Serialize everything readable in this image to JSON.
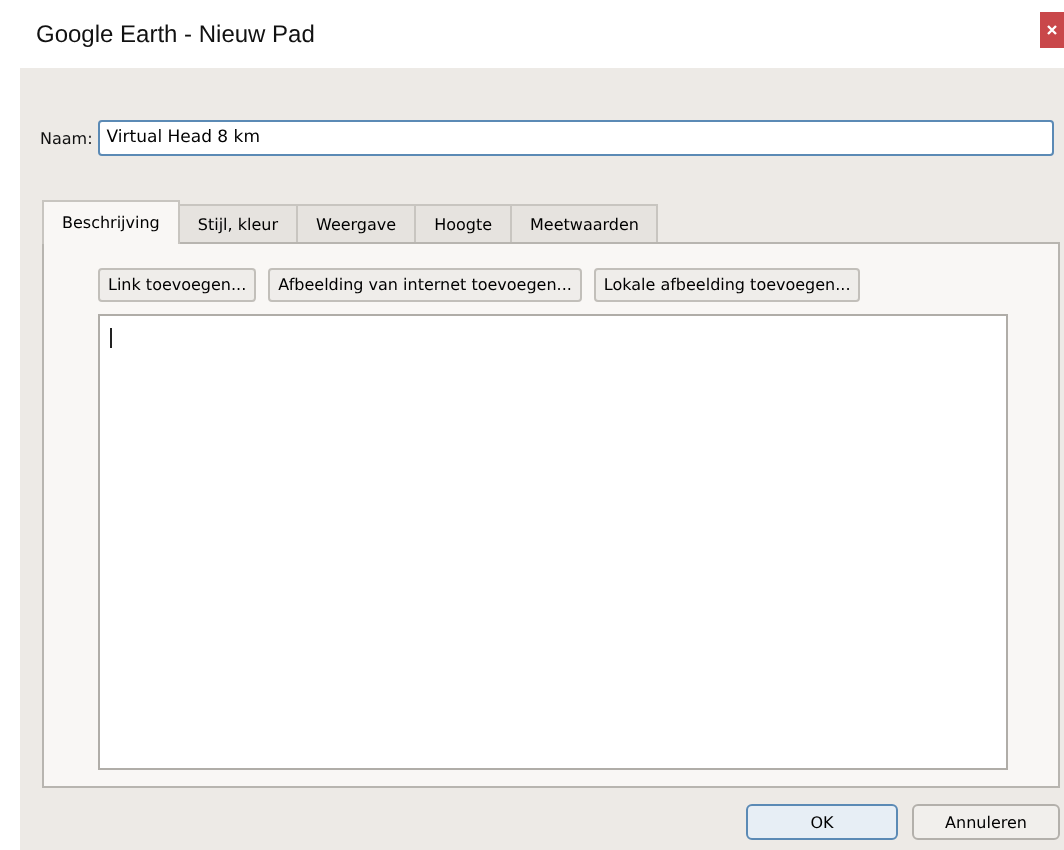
{
  "window": {
    "title": "Google Earth - Nieuw Pad"
  },
  "name_field": {
    "label": "Naam:",
    "value": "Virtual Head 8 km"
  },
  "tabs": [
    {
      "label": "Beschrijving",
      "selected": true
    },
    {
      "label": "Stijl, kleur",
      "selected": false
    },
    {
      "label": "Weergave",
      "selected": false
    },
    {
      "label": "Hoogte",
      "selected": false
    },
    {
      "label": "Meetwaarden",
      "selected": false
    }
  ],
  "toolbar_buttons": [
    "Link toevoegen...",
    "Afbeelding van internet toevoegen...",
    "Lokale afbeelding toevoegen..."
  ],
  "buttons": [
    {
      "label": "OK",
      "default": true
    },
    {
      "label": "Annuleren",
      "default": false
    }
  ]
}
